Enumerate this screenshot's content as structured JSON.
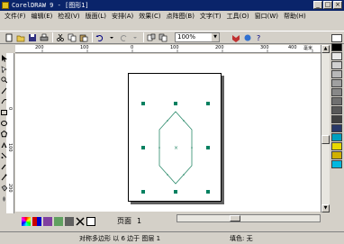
{
  "window": {
    "title": "CorelDRAW 9 - [图形1]",
    "min": "_",
    "max": "□",
    "close": "×"
  },
  "menu": [
    "文件(F)",
    "编辑(E)",
    "检视(V)",
    "版面(L)",
    "安排(A)",
    "效果(C)",
    "点阵图(B)",
    "文字(T)",
    "工具(O)",
    "窗口(W)",
    "帮助(H)"
  ],
  "toolbar": {
    "zoom_value": "100%"
  },
  "ruler": {
    "h_ticks": [
      "200",
      "100",
      "0",
      "100",
      "200",
      "300",
      "400"
    ],
    "h_unit": "毫米",
    "v_ticks": [
      "0",
      "100",
      "200"
    ]
  },
  "page_nav": {
    "label": "页面",
    "number": "1"
  },
  "status": {
    "left": "对称多边形 以 6 边于 图层 1",
    "right": "填色: 无"
  },
  "colors": {
    "selection_handle": "#008060",
    "shape_outline": "#2a8a6a",
    "title_bg": "#0a246a"
  },
  "palette": [
    "#ffffff",
    "#000000",
    "#e8e8e8",
    "#d0d0d0",
    "#b8b8b8",
    "#a0a0a0",
    "#888888",
    "#707070",
    "#585858",
    "#404040",
    "#283868",
    "#00a0c0",
    "#e8d800",
    "#d0b000",
    "#00b8e0"
  ]
}
